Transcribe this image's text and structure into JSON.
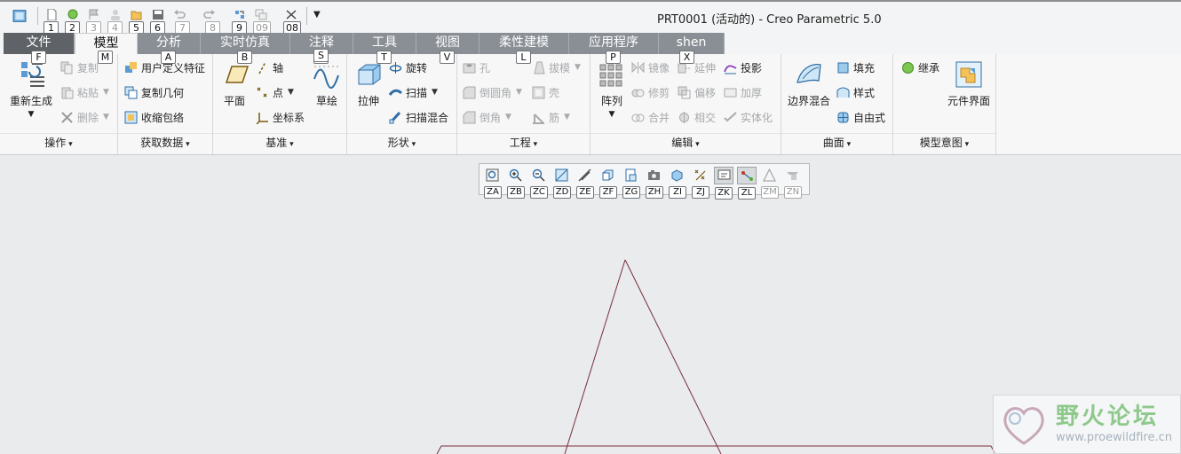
{
  "window": {
    "title": "PRT0001 (活动的) - Creo Parametric 5.0"
  },
  "quick_access": {
    "keys": [
      "1",
      "2",
      "3",
      "4",
      "5",
      "6",
      "7",
      "8",
      "9",
      "09",
      "08"
    ]
  },
  "tabs": [
    {
      "label": "文件",
      "key": "F"
    },
    {
      "label": "模型",
      "key": "M"
    },
    {
      "label": "分析",
      "key": "A"
    },
    {
      "label": "实时仿真",
      "key": "B"
    },
    {
      "label": "注释",
      "key": "S"
    },
    {
      "label": "工具",
      "key": "T"
    },
    {
      "label": "视图",
      "key": "V"
    },
    {
      "label": "柔性建模",
      "key": "L"
    },
    {
      "label": "应用程序",
      "key": "P"
    },
    {
      "label": "shen",
      "key": "X"
    }
  ],
  "groups": {
    "operations": {
      "label": "操作",
      "regenerate": "重新生成",
      "copy": "复制",
      "paste": "粘贴",
      "delete": "删除"
    },
    "get_data": {
      "label": "获取数据",
      "udf": "用户定义特征",
      "copy_geom": "复制几何",
      "shrinkwrap": "收缩包络"
    },
    "datum": {
      "label": "基准",
      "plane": "平面",
      "axis": "轴",
      "point": "点",
      "csys": "坐标系",
      "sketch": "草绘"
    },
    "shapes": {
      "label": "形状",
      "extrude": "拉伸",
      "revolve": "旋转",
      "sweep": "扫描",
      "swept_blend": "扫描混合"
    },
    "engineering": {
      "label": "工程",
      "hole": "孔",
      "round": "倒圆角",
      "chamfer": "倒角",
      "draft": "拔模",
      "shell": "壳",
      "rib": "筋"
    },
    "editing": {
      "label": "编辑",
      "pattern": "阵列",
      "mirror": "镜像",
      "trim": "修剪",
      "merge": "合并",
      "extend": "延伸",
      "offset": "偏移",
      "intersect": "相交",
      "project": "投影",
      "thicken": "加厚",
      "solidify": "实体化"
    },
    "surfaces": {
      "label": "曲面",
      "boundary_blend": "边界混合",
      "fill": "填充",
      "style": "样式",
      "freestyle": "自由式"
    },
    "model_intent": {
      "label": "模型意图",
      "inherit": "继承",
      "component_interface": "元件界面"
    }
  },
  "view_toolbar": {
    "keys": [
      "ZA",
      "ZB",
      "ZC",
      "ZD",
      "ZE",
      "ZF",
      "ZG",
      "ZH",
      "ZI",
      "ZJ",
      "ZK",
      "ZL",
      "ZM",
      "ZN"
    ]
  },
  "watermark": {
    "title": "野火论坛",
    "url": "www.proewildfire.cn"
  },
  "colors": {
    "accent_green": "#4fae2f",
    "model_line": "#7a2e3a",
    "tab_gray": "#8a8f95"
  }
}
